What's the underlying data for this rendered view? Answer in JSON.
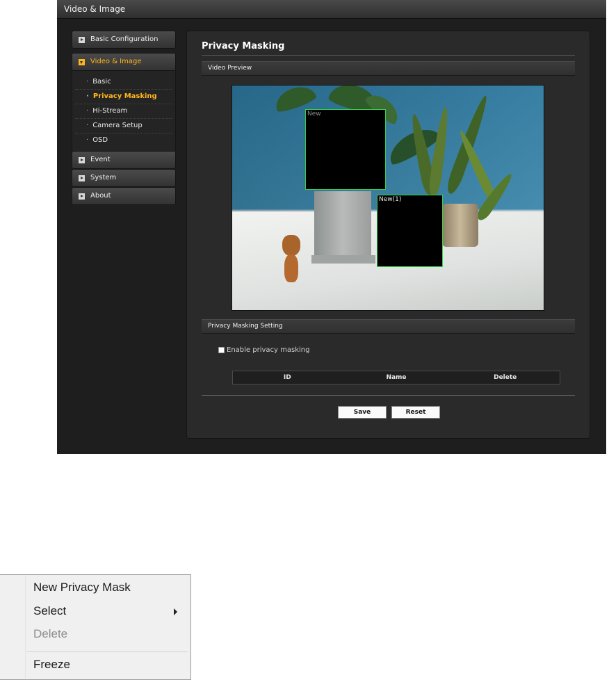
{
  "window": {
    "title": "Video & Image"
  },
  "sidebar": {
    "items": [
      {
        "label": "Basic Configuration",
        "active": false
      },
      {
        "label": "Video & Image",
        "active": true
      },
      {
        "label": "Event",
        "active": false
      },
      {
        "label": "System",
        "active": false
      },
      {
        "label": "About",
        "active": false
      }
    ],
    "subitems": [
      {
        "label": "Basic",
        "selected": false
      },
      {
        "label": "Privacy Masking",
        "selected": true
      },
      {
        "label": "Hi-Stream",
        "selected": false
      },
      {
        "label": "Camera Setup",
        "selected": false
      },
      {
        "label": "OSD",
        "selected": false
      }
    ],
    "bullet": "·"
  },
  "content": {
    "page_title": "Privacy Masking",
    "video_preview_header": "Video Preview",
    "masks": [
      {
        "name": "New"
      },
      {
        "name": "New(1)"
      }
    ],
    "setting_header": "Privacy Masking Setting",
    "enable_label": "Enable privacy masking",
    "enable_checked": false,
    "table_headers": [
      "ID",
      "Name",
      "Delete"
    ],
    "save_label": "Save",
    "reset_label": "Reset"
  },
  "context_menu": {
    "items": [
      {
        "label": "New Privacy Mask",
        "enabled": true
      },
      {
        "label": "Select",
        "enabled": true,
        "submenu": true
      },
      {
        "label": "Delete",
        "enabled": false
      },
      {
        "label": "Freeze",
        "enabled": true
      }
    ]
  },
  "colors": {
    "accent": "#ffb51c",
    "mask_border": "#35d04a",
    "window_bg": "#1e1e1e",
    "panel_bg": "#2a2a2a"
  }
}
